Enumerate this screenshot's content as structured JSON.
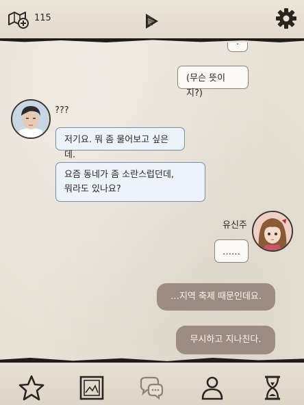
{
  "header": {
    "currency_value": "115",
    "icons": [
      "map-plus-icon",
      "play-icon",
      "gear-icon"
    ]
  },
  "chat": {
    "top_partial": ":",
    "messages": [
      {
        "side": "right",
        "text": "(무슨 뜻이지?)"
      },
      {
        "side": "left",
        "speaker": "???",
        "avatar": "man-avatar",
        "text": "저기요. 뭐 좀 물어보고 싶은데."
      },
      {
        "side": "left",
        "text_line1": "요즘 동네가 좀 소란스럽던데,",
        "text_line2": "뭐라도 있나요?"
      },
      {
        "side": "right",
        "speaker": "유신주",
        "avatar": "girl-avatar",
        "text": "……"
      }
    ],
    "choices": [
      {
        "text": "…지역 축제 때문인데요."
      },
      {
        "text": "무시하고 지나친다."
      }
    ]
  },
  "bottom_nav": [
    {
      "name": "star-icon"
    },
    {
      "name": "picture-frame-icon"
    },
    {
      "name": "chat-bubbles-icon",
      "active": true
    },
    {
      "name": "person-icon"
    },
    {
      "name": "hourglass-icon"
    }
  ],
  "colors": {
    "paper": "#e8e1d6",
    "choice_bg": "#9c8c84",
    "left_bubble_bg": "#edf3fb",
    "border_dark": "#1f1b18"
  }
}
